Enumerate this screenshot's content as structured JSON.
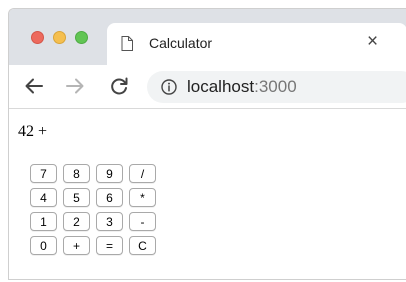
{
  "browser": {
    "tab": {
      "title": "Calculator",
      "close_glyph": "×",
      "icon": "page-icon"
    },
    "nav": {
      "back_icon": "arrow-back-icon",
      "forward_icon": "arrow-forward-icon",
      "reload_icon": "reload-icon"
    },
    "address": {
      "icon": "info-icon",
      "host": "localhost",
      "port": ":3000"
    },
    "colors": {
      "close_dot": "#ed6a5e",
      "minimize_dot": "#f5bf4f",
      "maximize_dot": "#61c554",
      "tabbar_bg": "#dee1e6",
      "omnibox_bg": "#f1f3f4"
    }
  },
  "calculator": {
    "display": "42 +",
    "keys": [
      [
        "7",
        "8",
        "9",
        "/"
      ],
      [
        "4",
        "5",
        "6",
        "*"
      ],
      [
        "1",
        "2",
        "3",
        "-"
      ],
      [
        "0",
        "+",
        "=",
        "C"
      ]
    ]
  }
}
